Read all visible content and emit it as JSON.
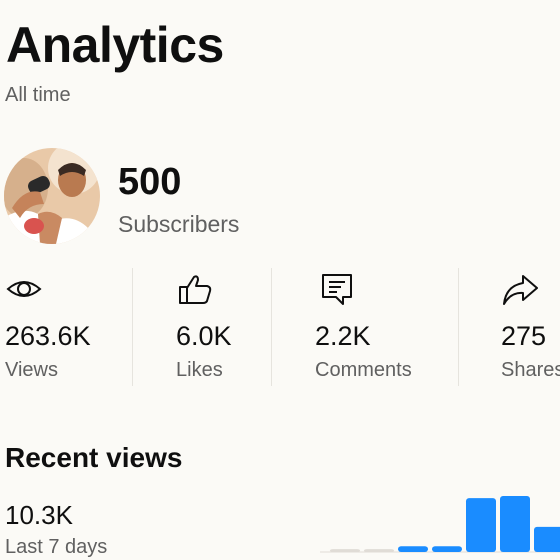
{
  "header": {
    "title": "Analytics",
    "period": "All time"
  },
  "channel": {
    "subscriber_count": "500",
    "subscriber_label": "Subscribers"
  },
  "stats": [
    {
      "icon": "eye-icon",
      "value": "263.6K",
      "label": "Views"
    },
    {
      "icon": "thumbs-up-icon",
      "value": "6.0K",
      "label": "Likes"
    },
    {
      "icon": "comment-icon",
      "value": "2.2K",
      "label": "Comments"
    },
    {
      "icon": "share-icon",
      "value": "275",
      "label": "Shares"
    }
  ],
  "recent": {
    "title": "Recent views",
    "value": "10.3K",
    "period": "Last 7 days"
  },
  "chart_data": {
    "type": "bar",
    "values": [
      0.4,
      0.4,
      0.8,
      0.8,
      7.5,
      7.8,
      3.5
    ],
    "highlight_color": "#1a8cff",
    "base_color": "#e0dcd6"
  },
  "colors": {
    "accent": "#1a8cff",
    "background": "#fbfaf6",
    "secondary_text": "#606060"
  }
}
